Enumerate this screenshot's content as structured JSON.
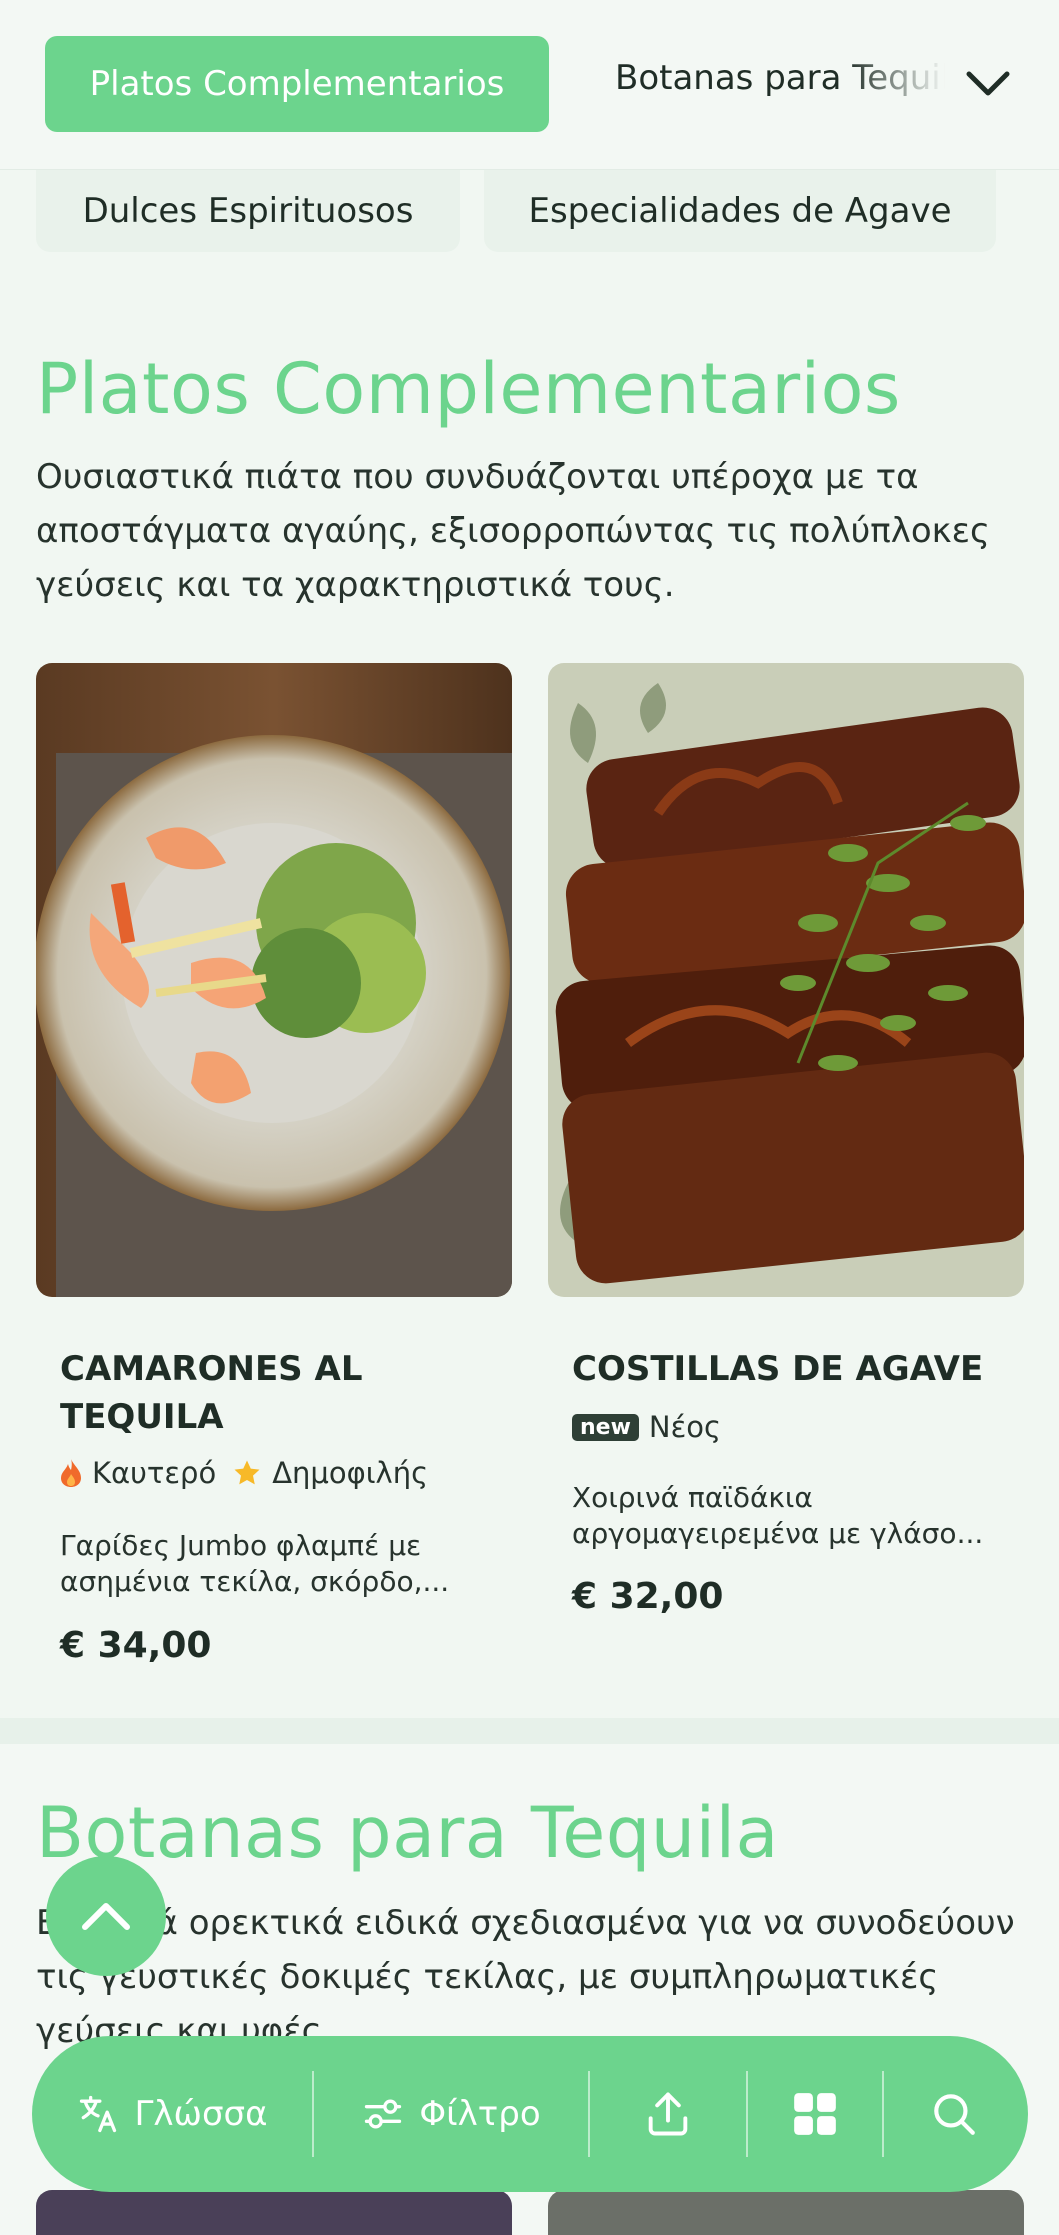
{
  "topbar": {
    "active_category": "Platos Complementarios",
    "next_category": "Botanas para Tequila",
    "toggle_icon": "chevron-down-icon"
  },
  "chips": [
    "Dulces Espirituosos",
    "Especialidades de Agave"
  ],
  "section1": {
    "title": "Platos Complementarios",
    "description": "Ουσιαστικά πιάτα που συνδυάζονται υπέροχα με τα αποστάγματα αγαύης, εξισορροπώντας τις πολύπλοκες γεύσεις και τα χαρακτηριστικά τους."
  },
  "cards": [
    {
      "name": "CAMARONES AL TEQUILA",
      "tags": [
        {
          "icon": "flame-icon",
          "label": "Καυτερό"
        },
        {
          "icon": "star-icon",
          "label": "Δημοφιλής"
        }
      ],
      "description": "Γαρίδες Jumbo φλαμπέ με ασημένια τεκίλα, σκόρδο,...",
      "price": "€ 34,00"
    },
    {
      "name": "COSTILLAS DE AGAVE",
      "badge": "new",
      "badge_label": "Νέος",
      "description": "Χοιρινά παϊδάκια αργομαγειρεμένα με γλάσο...",
      "price": "€ 32,00"
    }
  ],
  "section2": {
    "title": "Botanas para Tequila",
    "description": "Ελαφριά ορεκτικά ειδικά σχεδιασμένα για να συνοδεύουν τις γευστικές δοκιμές τεκίλας, με συμπληρωματικές γεύσεις και υφές."
  },
  "bottom_nav": {
    "language_label": "Γλώσσα",
    "filter_label": "Φίλτρο"
  },
  "colors": {
    "accent": "#6cd48d",
    "background": "#f1f7f2",
    "text": "#1f2d26"
  }
}
